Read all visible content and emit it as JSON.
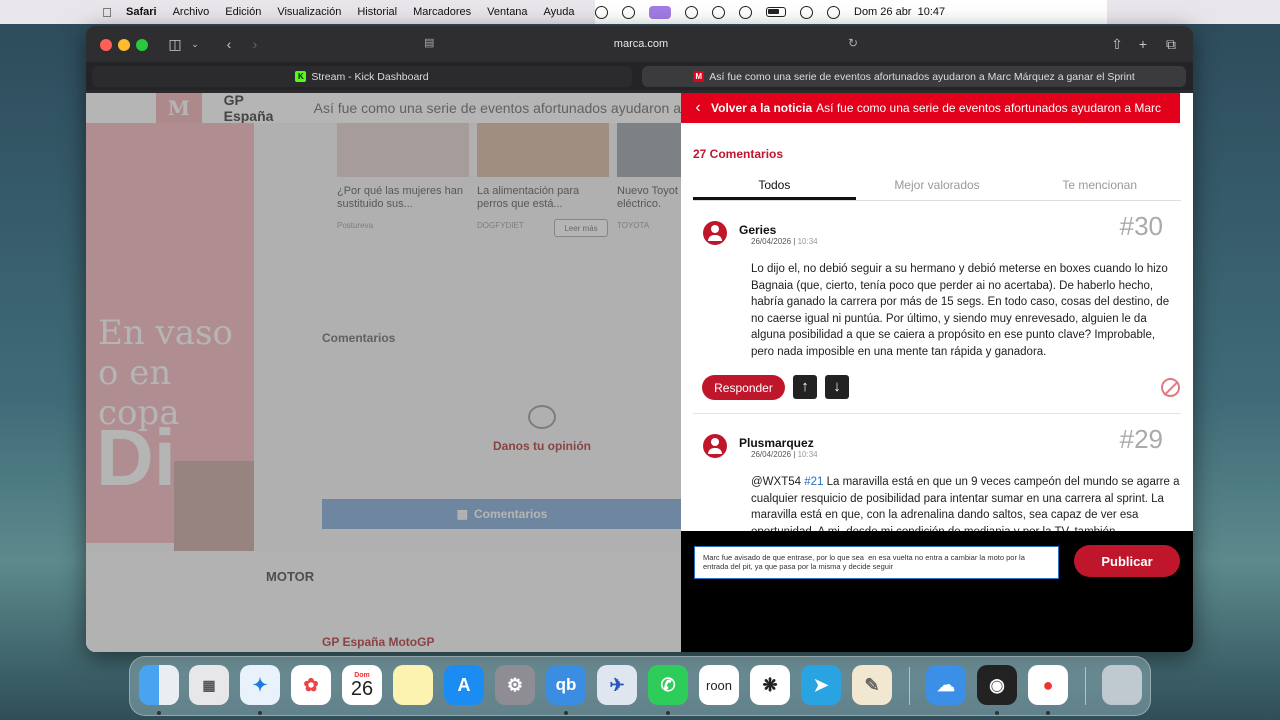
{
  "menubar": {
    "app": "Safari",
    "menus": [
      "Archivo",
      "Edición",
      "Visualización",
      "Historial",
      "Marcadores",
      "Ventana",
      "Ayuda"
    ],
    "datetime": "Dom 26 abr  10:47"
  },
  "browser": {
    "url": "marca.com",
    "tabs": [
      {
        "title": "Stream - Kick Dashboard",
        "favicon": "K"
      },
      {
        "title": "Así fue como una serie de eventos afortunados ayudaron a Marc Márquez a ganar el Sprint",
        "favicon": "M"
      }
    ]
  },
  "page": {
    "logo": "M",
    "section": "GP España",
    "headline_truncated": "Así fue como una serie de eventos afortunados ayudaron a",
    "ad": {
      "line1": "En vaso",
      "line2": "o en copa",
      "big": "Di"
    },
    "cards": [
      {
        "title": "¿Por qué las mujeres han sustituido sus...",
        "source": "Postureva"
      },
      {
        "title": "La alimentación para perros que está...",
        "source": "DOGFYDIET",
        "cta": "Leer más"
      },
      {
        "title": "Nuevo Toyot eléctrico.",
        "source": "TOYOTA"
      }
    ],
    "comments_heading": "Comentarios",
    "empty_state": "Danos tu opinión",
    "comments_button": "Comentarios",
    "motor_heading": "MOTOR",
    "gp_heading": "GP España MotoGP"
  },
  "comments_panel": {
    "back_label": "Volver a la noticia",
    "title": "Así fue como una serie de eventos afortunados ayudaron a Marc",
    "count": "27 Comentarios",
    "tabs": [
      "Todos",
      "Mejor valorados",
      "Te mencionan"
    ],
    "comments": [
      {
        "user": "Geries",
        "date": "26/04/2026",
        "time": "10:34",
        "number": "#30",
        "text": "Lo dijo el, no debió seguir a su hermano y debió meterse en boxes cuando lo hizo Bagnaia (que, cierto, tenía poco que perder ai no acertaba). De haberlo hecho, habría ganado la carrera por más de 15 segs. En todo caso, cosas del destino, de no caerse igual ni puntúa. Por último, y siendo muy enrevesado, alguien le da alguna posibilidad a que se caiera a propósito en ese punto clave? Improbable, pero nada imposible en una mente tan rápida y ganadora."
      },
      {
        "user": "Plusmarquez",
        "date": "26/04/2026",
        "time": "10:34",
        "number": "#29",
        "mention": "@WXT54",
        "ref": "#21",
        "text": "La maravilla está en que un 9 veces campeón del mundo se agarre a cualquier resquicio de posibilidad para intentar sumar en una carrera al sprint. La maravilla está en que, con la adrenalina dando saltos, sea capaz de ver esa oportunidad. A mi, desde mi condición de mediania y por la TV, también"
      }
    ],
    "reply_label": "Responder",
    "compose_text": "Marc fue avisado de que entrase, por lo que sea  en esa vuelta no entra a cambiar la moto por la entrada del pit, ya que pasa por la misma y decide seguir",
    "publish_label": "Publicar"
  },
  "dock": {
    "calendar_month": "Dom",
    "calendar_day": "26",
    "apps": [
      "finder",
      "launchpad",
      "safari",
      "photos",
      "calendar",
      "notes",
      "app-store",
      "system-settings",
      "qbittorrent",
      "airplane",
      "whatsapp",
      "roon",
      "chatgpt",
      "telegram",
      "textedit",
      "weather",
      "obs",
      "chrome",
      "trash"
    ],
    "qb_label": "qb",
    "roon_label": "roon"
  }
}
